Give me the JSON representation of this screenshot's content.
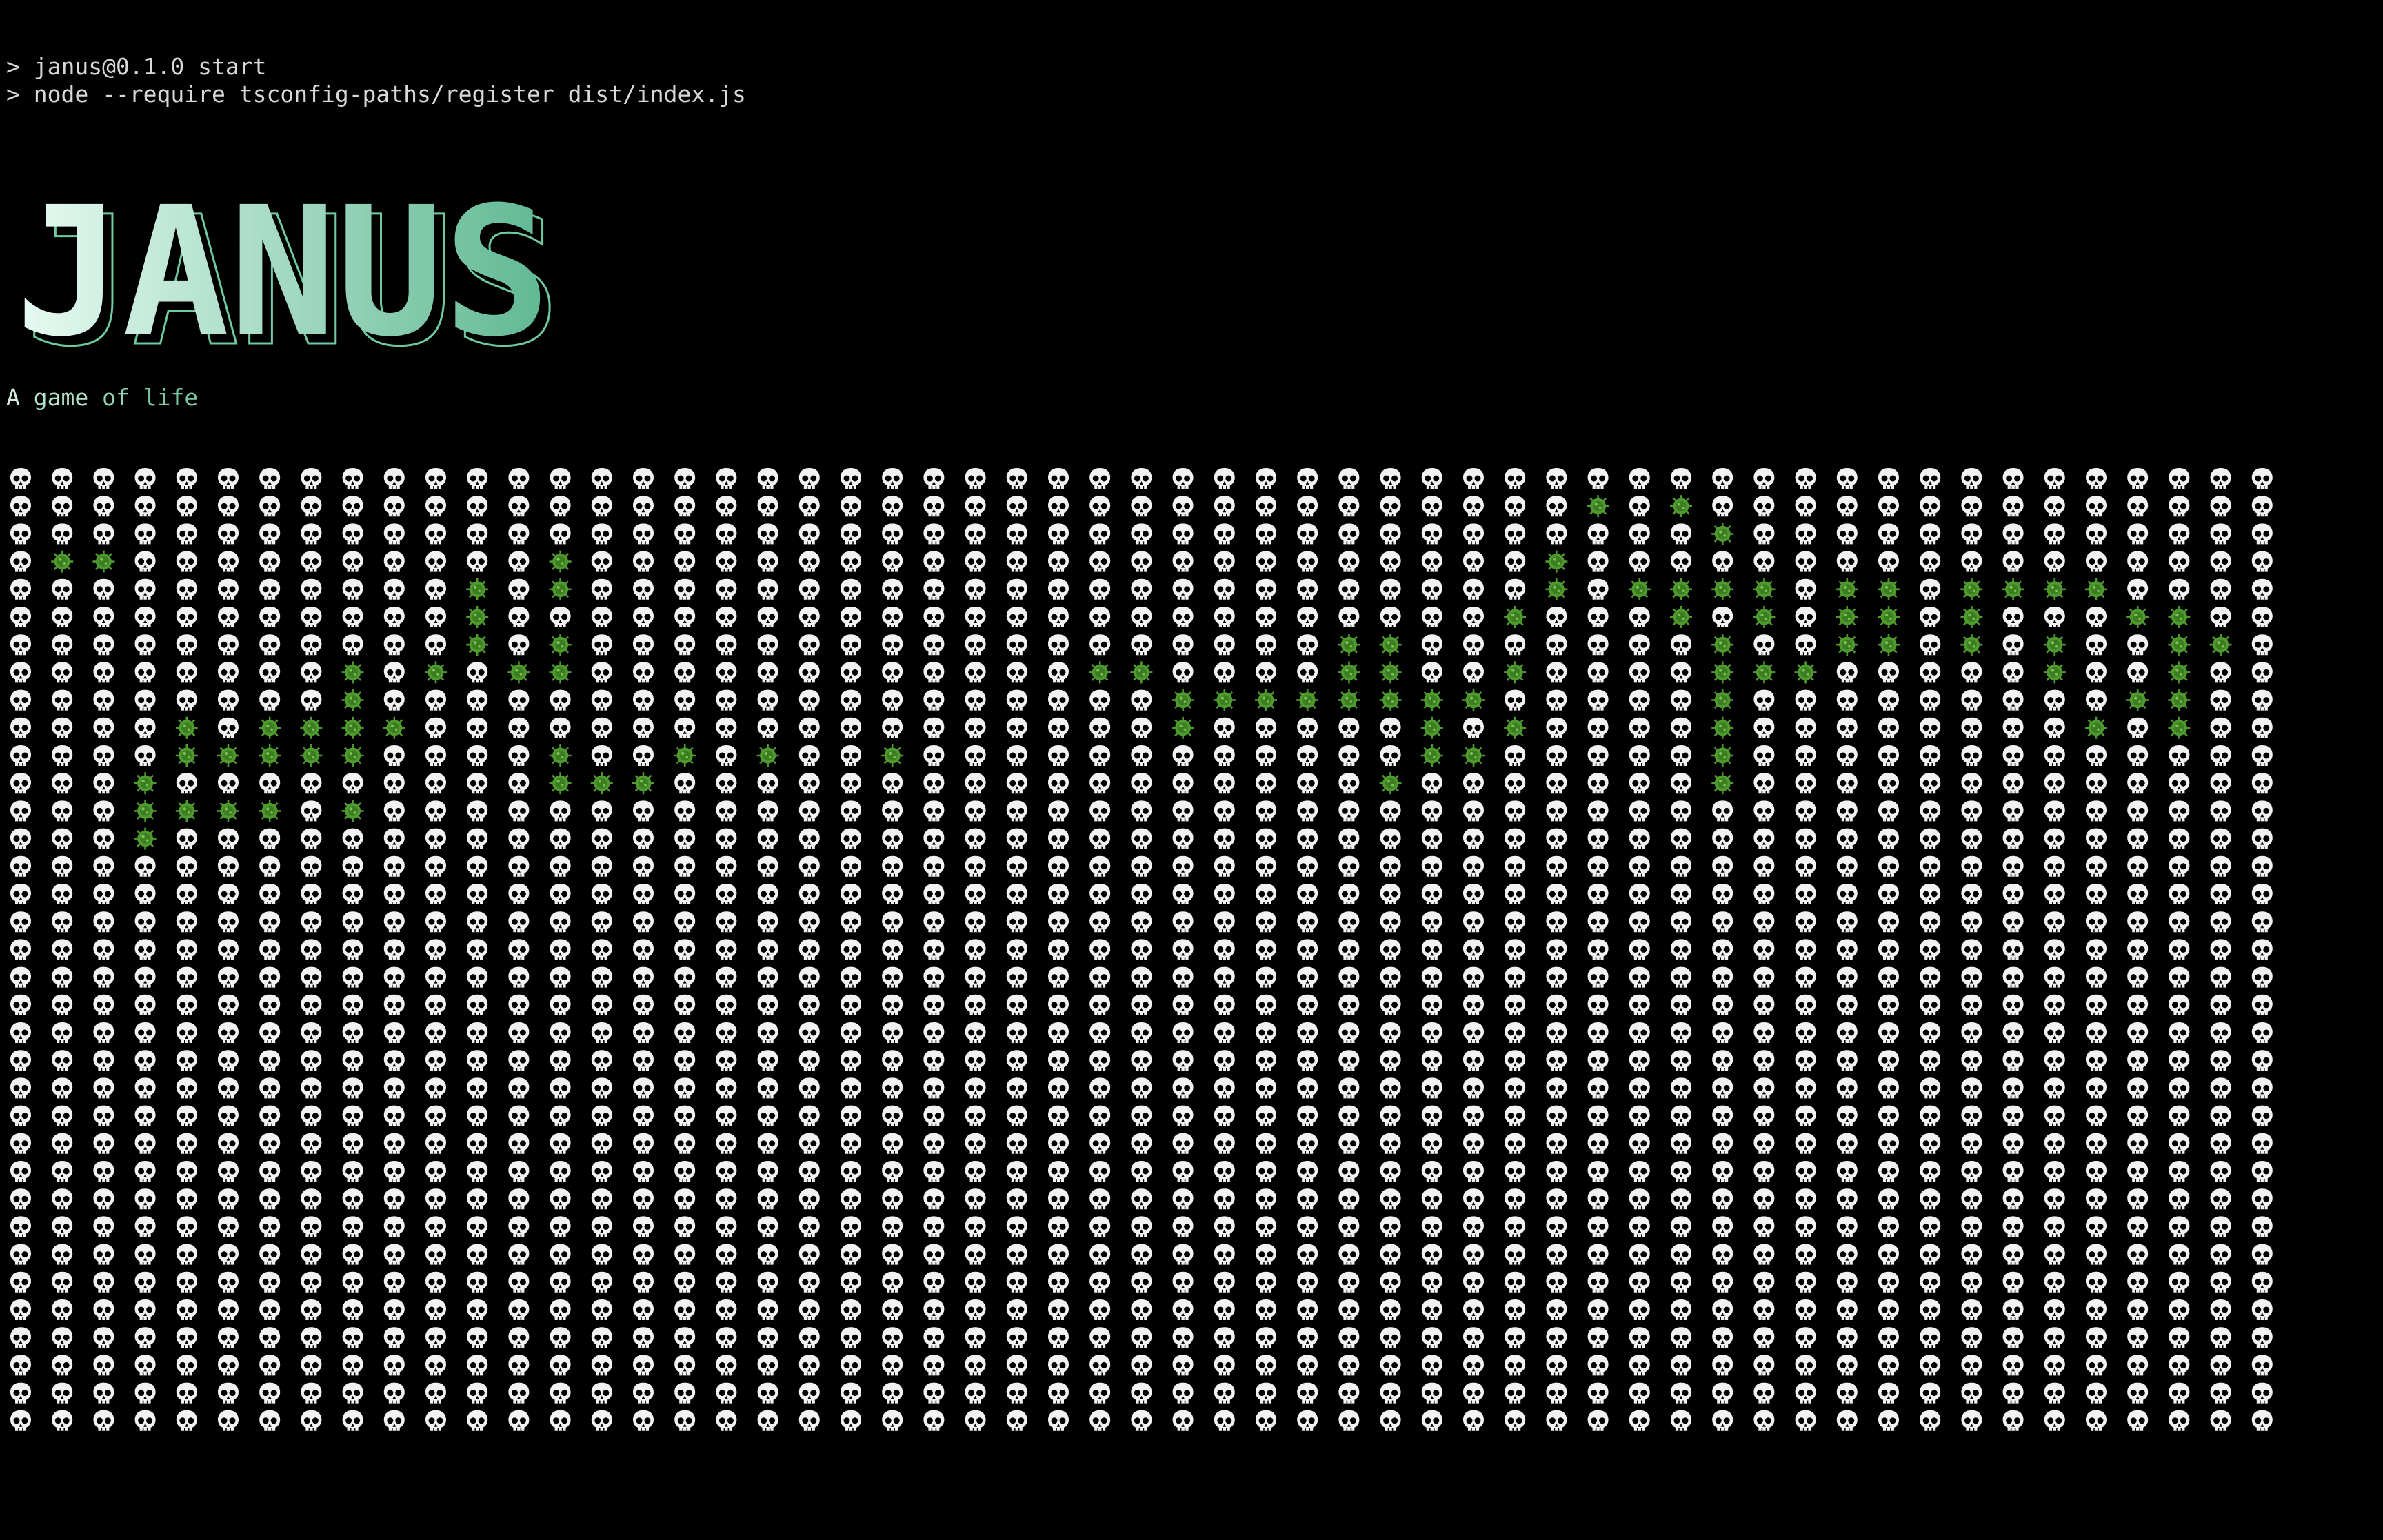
{
  "terminal": {
    "command_line_1": "> janus@0.1.0 start",
    "command_line_2": "> node --require tsconfig-paths/register dist/index.js"
  },
  "banner": {
    "title": "JANUS",
    "gradient_start": "#e8fbf3",
    "gradient_end": "#5fb893",
    "outline_color": "#6fcaa2"
  },
  "tagline": {
    "word_1": "A",
    "word_2": "game",
    "word_3": "of",
    "word_4": "life"
  },
  "board": {
    "columns": 55,
    "rows": 35,
    "dead_cell_icon": "skull-icon",
    "live_cell_icon": "virus-icon",
    "dead_color": "#f2f2f2",
    "live_color": "#4f9a2f",
    "cells": [
      "0000000000000000000000000000000000000000000000000000000",
      "0000000000000000000000000000000000000010100000000000000",
      "0000000000000000000000000000000000000000010000000000000",
      "0110000000000100000000000000000000000100000000000000000",
      "0000000000010100000000000000000000000101111011011110000",
      "0000000000010000000000000000000000001000101011010001100",
      "0000000000010100000000000000000011000000010011010100110",
      "0000000010101100000000000011000011001000011100000100100",
      "0000000010000000000000000000111111110000010000000001100",
      "0000101111000000000000000000100000101000010000000010100",
      "0000111110000100101001000000000000110000010000000000000",
      "0001000000000111000000000000000001000000010000000000000",
      "0001111010000000000000000000000000000000000000000000000",
      "0001000000000000000000000000000000000000000000000000000",
      "0000000000000000000000000000000000000000000000000000000",
      "0000000000000000000000000000000000000000000000000000000",
      "0000000000000000000000000000000000000000000000000000000",
      "0000000000000000000000000000000000000000000000000000000",
      "0000000000000000000000000000000000000000000000000000000",
      "0000000000000000000000000000000000000000000000000000000",
      "0000000000000000000000000000000000000000000000000000000",
      "0000000000000000000000000000000000000000000000000000000",
      "0000000000000000000000000000000000000000000000000000000",
      "0000000000000000000000000000000000000000000000000000000",
      "0000000000000000000000000000000000000000000000000000000",
      "0000000000000000000000000000000000000000000000000000000",
      "0000000000000000000000000000000000000000000000000000000",
      "0000000000000000000000000000000000000000000000000000000",
      "0000000000000000000000000000000000000000000000000000000",
      "0000000000000000000000000000000000000000000000000000000",
      "0000000000000000000000000000000000000000000000000000000",
      "0000000000000000000000000000000000000000000000000000000",
      "0000000000000000000000000000000000000000000000000000000",
      "0000000000000000000000000000000000000000000000000000000",
      "0000000000000000000000000000000000000000000000000000000"
    ]
  }
}
